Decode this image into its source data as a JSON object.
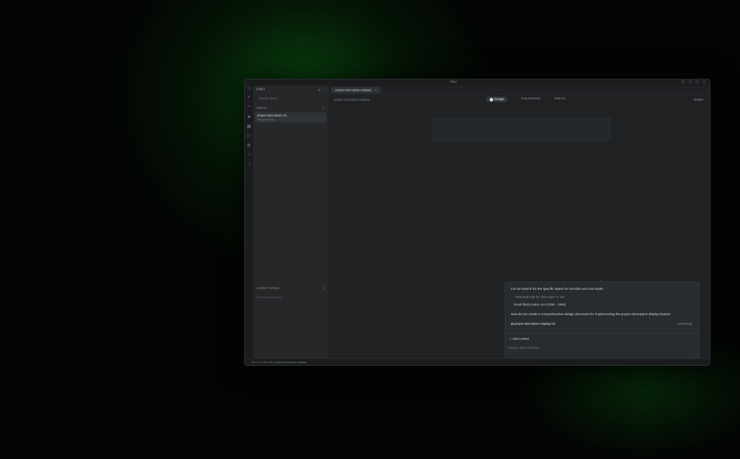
{
  "window": {
    "title": "Kiro",
    "controls": "▢ ▢ ▢ ▢"
  },
  "rail": {
    "icons": [
      "files-icon",
      "search-icon",
      "source-control-icon",
      "kiro-icon",
      "extensions-icon",
      "debug-icon",
      "settings-icon",
      "account-icon",
      "bell-icon"
    ]
  },
  "sidebar": {
    "header": "KIRO",
    "search_placeholder": "Search specs",
    "specs_section": "SPECS",
    "items": [
      {
        "title": "project-description-di...",
        "sub": "Requirements"
      }
    ],
    "bottom_section": "AGENT HOOKS",
    "bottom_sub": "No hooks configured"
  },
  "tabbar": {
    "active_tab": "project-description-display",
    "close_glyph": "×"
  },
  "subbar": {
    "breadcrumb": "project-description-display",
    "segments": [
      "Design",
      "Requirements",
      "Task list"
    ],
    "active_segment": 0,
    "right_action": "Refine"
  },
  "chat": {
    "scroll_indicator": "⌃",
    "m1": "Let me search for the specific styles for non-title and non-mode:",
    "m2": "› Searched code for \"font-mono\" in .tsx",
    "m3": "Read file(s) index.css (1309 - 1589)",
    "m4": "Now let me create a comprehensive design document for implementing the project description display feature:",
    "file_chip": "project-description-display.md",
    "file_status": "Generating",
    "add_context": "+ Add Context",
    "input_placeholder": "Design, plan and build...",
    "send_glyph": "↑"
  },
  "statusbar": {
    "text": "⊗ 0  ⚠ 0   main   Kiro   project-description-display"
  }
}
